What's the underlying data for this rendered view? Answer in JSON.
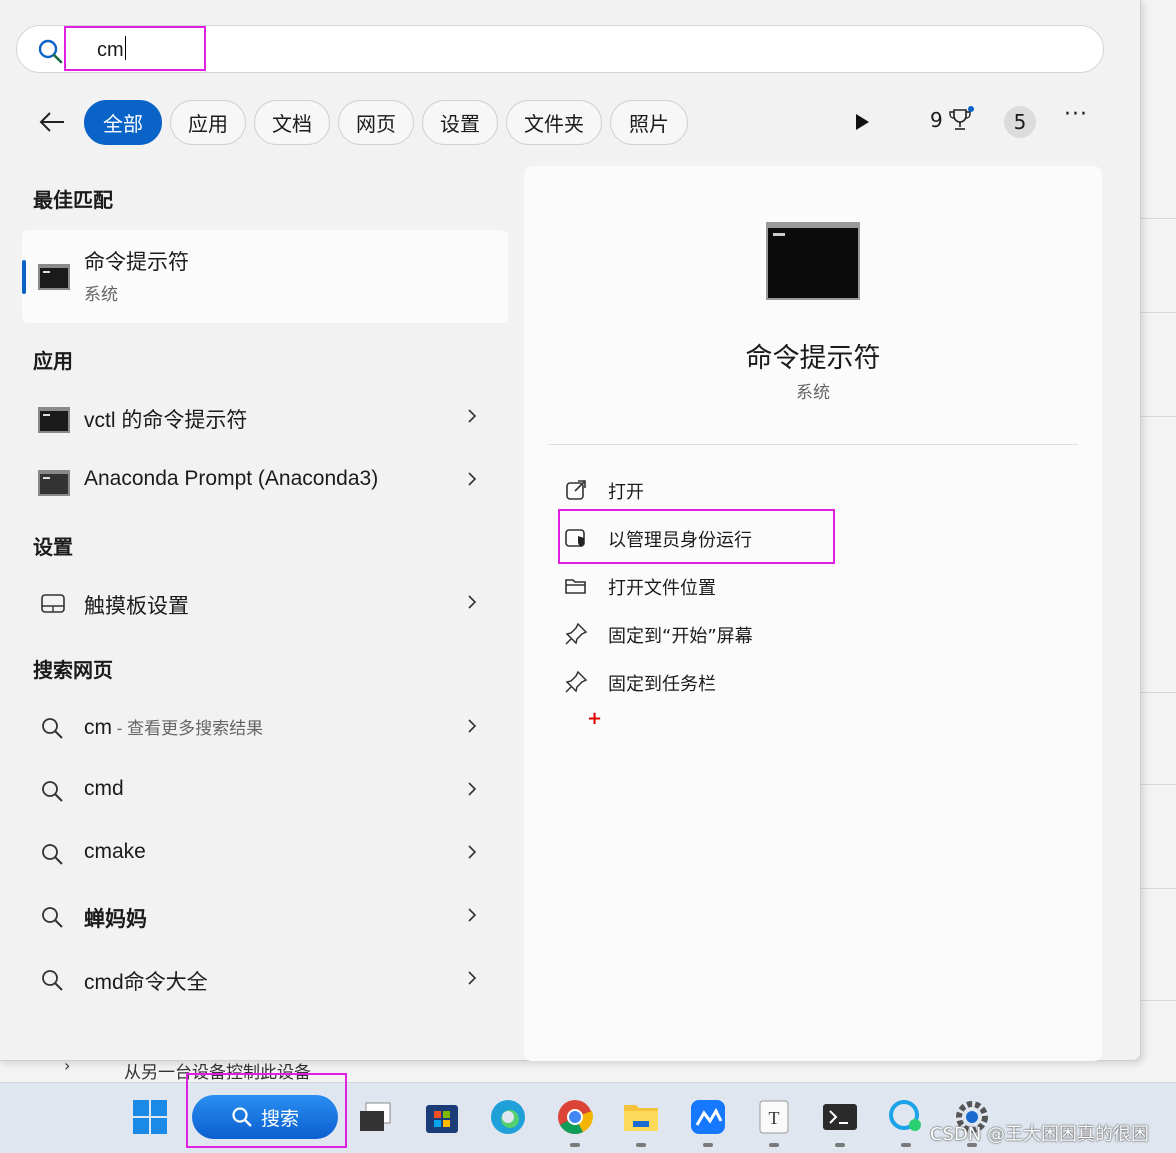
{
  "search": {
    "query": "cm"
  },
  "filters": {
    "tabs": [
      "全部",
      "应用",
      "文档",
      "网页",
      "设置",
      "文件夹",
      "照片"
    ],
    "rewards_points": "9",
    "notification_count": "5",
    "more": "···"
  },
  "results": {
    "best_match_title": "最佳匹配",
    "best_match": {
      "name": "命令提示符",
      "type": "系统"
    },
    "apps_title": "应用",
    "apps": [
      {
        "label": "vctl 的命令提示符"
      },
      {
        "label": "Anaconda Prompt (Anaconda3)"
      }
    ],
    "settings_title": "设置",
    "settings": [
      {
        "label": "触摸板设置"
      }
    ],
    "web_title": "搜索网页",
    "web": [
      {
        "prefix": "cm",
        "suffix": " - 查看更多搜索结果"
      },
      {
        "label": "cmd"
      },
      {
        "label": "cmake"
      },
      {
        "label": "蝉妈妈"
      },
      {
        "label": "cmd命令大全"
      }
    ]
  },
  "preview": {
    "name": "命令提示符",
    "type": "系统",
    "actions": [
      {
        "label": "打开",
        "icon": "open-external-icon"
      },
      {
        "label": "以管理员身份运行",
        "icon": "admin-shield-icon"
      },
      {
        "label": "打开文件位置",
        "icon": "folder-icon"
      },
      {
        "label": "固定到“开始”屏幕",
        "icon": "pin-icon"
      },
      {
        "label": "固定到任务栏",
        "icon": "pin-icon"
      }
    ]
  },
  "background": {
    "row_text": "从另一台设备控制此设备"
  },
  "taskbar": {
    "search_label": "搜索"
  },
  "watermark": "CSDN @王大困困真的很困",
  "colors": {
    "accent": "#0a64c8",
    "highlight": "#e020e0"
  }
}
